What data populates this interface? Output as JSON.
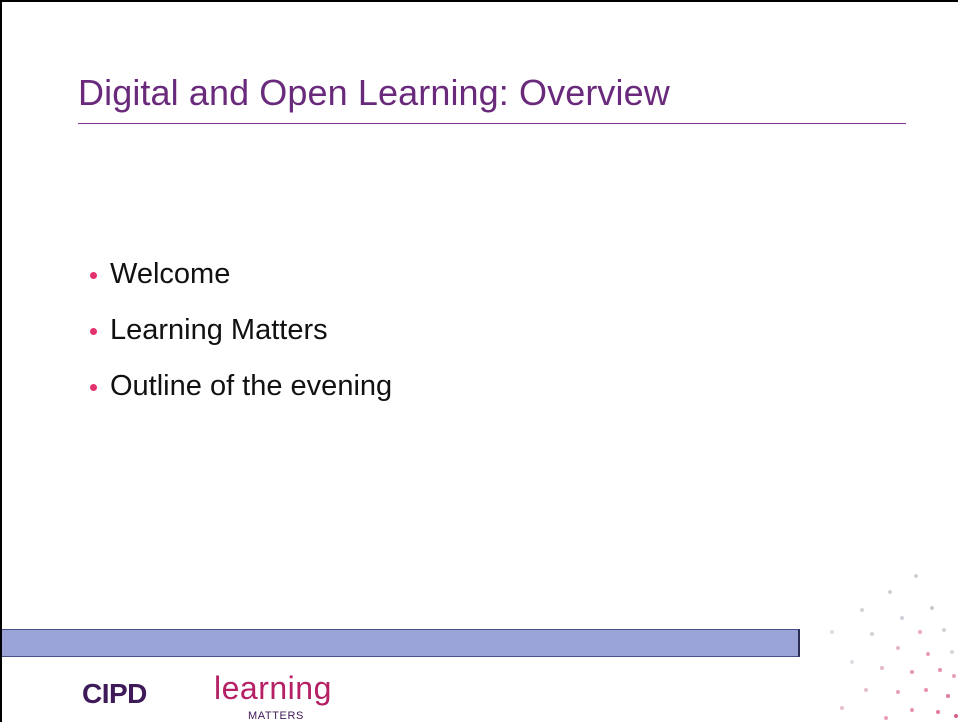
{
  "slide": {
    "title": "Digital and Open Learning: Overview",
    "bullets": [
      "Welcome",
      "Learning Matters",
      "Outline of the evening"
    ]
  },
  "footer": {
    "logo_cipd": "CIPD",
    "logo_learning": "learning",
    "logo_matters": "MATTERS"
  },
  "colors": {
    "title": "#6a2a7c",
    "bullet": "#e3306f",
    "footer_bar": "#9aa4d6",
    "logo_cipd": "#3f1a59",
    "logo_learning": "#b51f64"
  }
}
